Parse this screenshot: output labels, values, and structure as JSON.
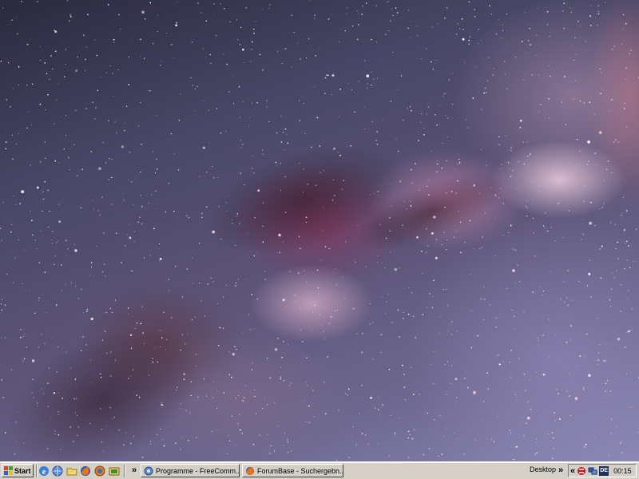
{
  "desktop": {
    "wallpaper": "milky-way-starfield"
  },
  "taskbar": {
    "start_label": "Start",
    "quick_launch": [
      "ie-icon",
      "browser-icon",
      "folder-icon",
      "firefox-icon",
      "globe-icon",
      "explorer-icon"
    ],
    "chevron": "»",
    "tasks": [
      {
        "label": "Programme - FreeComm...",
        "icon": "freecommander-icon"
      },
      {
        "label": "ForumBase - Suchergebn...",
        "icon": "firefox-icon"
      }
    ],
    "desktop_toolbar_label": "Desktop",
    "toolbar_chevron": "»",
    "tray": {
      "chevron": "«",
      "icons": [
        "antivirus-icon",
        "network-icon",
        "language-icon"
      ],
      "language_badge": "DE",
      "clock": "00:15"
    }
  },
  "colors": {
    "taskbar_bg": "#d4d0c8",
    "sky_dark": "#2a2a3e",
    "nebula_pink": "#e08fb5",
    "core_bright": "#ffdcea"
  }
}
